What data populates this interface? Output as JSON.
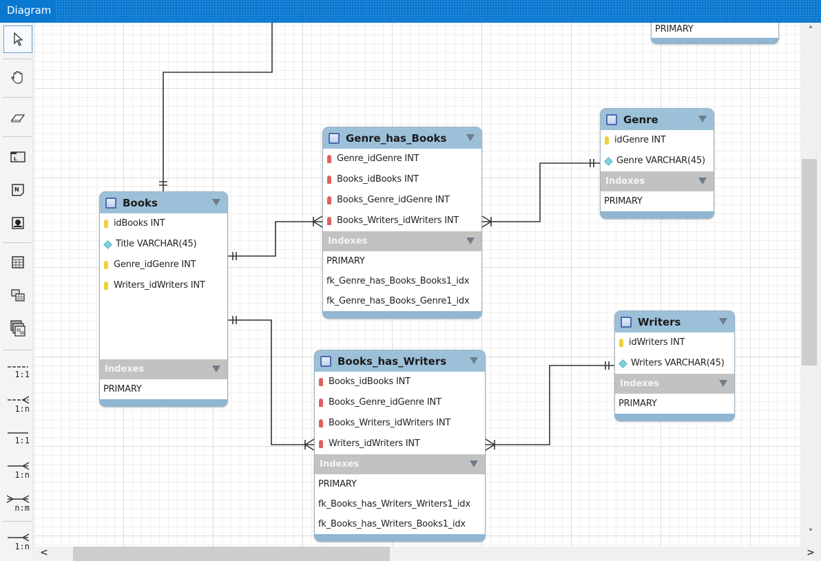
{
  "window": {
    "title": "Diagram"
  },
  "toolbar": {
    "tools": [
      {
        "name": "select-tool",
        "icon": "pointer-icon"
      },
      {
        "name": "hand-tool",
        "icon": "hand-icon"
      },
      {
        "name": "eraser-tool",
        "icon": "eraser-icon"
      },
      {
        "name": "layer-tool",
        "icon": "layer-icon",
        "glyph": "L"
      },
      {
        "name": "note-tool",
        "icon": "note-icon",
        "glyph": "N"
      },
      {
        "name": "image-tool",
        "icon": "image-icon"
      },
      {
        "name": "table-tool",
        "icon": "table-icon"
      },
      {
        "name": "view-tool",
        "icon": "view-icon"
      },
      {
        "name": "routine-group-tool",
        "icon": "routine-group-icon"
      },
      {
        "name": "rel-1-1-non-identifying",
        "label": "1:1"
      },
      {
        "name": "rel-1-n-non-identifying",
        "label": "1:n"
      },
      {
        "name": "rel-1-1-identifying",
        "label": "1:1"
      },
      {
        "name": "rel-1-n-identifying",
        "label": "1:n"
      },
      {
        "name": "rel-n-m-identifying",
        "label": "n:m"
      },
      {
        "name": "rel-1-n-existing-columns",
        "label": "1:n"
      }
    ]
  },
  "entities": {
    "partial": {
      "indexes": [
        "PRIMARY"
      ]
    },
    "books": {
      "title": "Books",
      "columns": [
        {
          "name": "idBooks INT",
          "kind": "pk"
        },
        {
          "name": "Title VARCHAR(45)",
          "kind": "attr"
        },
        {
          "name": "Genre_idGenre INT",
          "kind": "pk"
        },
        {
          "name": "Writers_idWriters INT",
          "kind": "pk"
        }
      ],
      "indexes_label": "Indexes",
      "indexes": [
        "PRIMARY"
      ]
    },
    "genre_has_books": {
      "title": "Genre_has_Books",
      "columns": [
        {
          "name": "Genre_idGenre INT",
          "kind": "fk"
        },
        {
          "name": "Books_idBooks INT",
          "kind": "fk"
        },
        {
          "name": "Books_Genre_idGenre INT",
          "kind": "fk"
        },
        {
          "name": "Books_Writers_idWriters INT",
          "kind": "fk"
        }
      ],
      "indexes_label": "Indexes",
      "indexes": [
        "PRIMARY",
        "fk_Genre_has_Books_Books1_idx",
        "fk_Genre_has_Books_Genre1_idx"
      ]
    },
    "genre": {
      "title": "Genre",
      "columns": [
        {
          "name": "idGenre INT",
          "kind": "pk"
        },
        {
          "name": "Genre VARCHAR(45)",
          "kind": "attr"
        }
      ],
      "indexes_label": "Indexes",
      "indexes": [
        "PRIMARY"
      ]
    },
    "books_has_writers": {
      "title": "Books_has_Writers",
      "columns": [
        {
          "name": "Books_idBooks INT",
          "kind": "fk"
        },
        {
          "name": "Books_Genre_idGenre INT",
          "kind": "fk"
        },
        {
          "name": "Books_Writers_idWriters INT",
          "kind": "fk"
        },
        {
          "name": "Writers_idWriters INT",
          "kind": "fk"
        }
      ],
      "indexes_label": "Indexes",
      "indexes": [
        "PRIMARY",
        "fk_Books_has_Writers_Writers1_idx",
        "fk_Books_has_Writers_Books1_idx"
      ]
    },
    "writers": {
      "title": "Writers",
      "columns": [
        {
          "name": "idWriters INT",
          "kind": "pk"
        },
        {
          "name": "Writers VARCHAR(45)",
          "kind": "attr"
        }
      ],
      "indexes_label": "Indexes",
      "indexes": [
        "PRIMARY"
      ]
    }
  },
  "relationships": [
    {
      "from": "offscreen",
      "to": "Books",
      "type": "one-to-one-mandatory"
    },
    {
      "from": "Books",
      "to": "Genre_has_Books",
      "type": "one-to-many"
    },
    {
      "from": "Genre",
      "to": "Genre_has_Books",
      "type": "one-to-many"
    },
    {
      "from": "Books",
      "to": "Books_has_Writers",
      "type": "one-to-many"
    },
    {
      "from": "Writers",
      "to": "Books_has_Writers",
      "type": "one-to-many"
    }
  ],
  "scrollbars": {
    "up_arrow": "˄",
    "down_arrow": "˅",
    "left_arrow": "<",
    "right_arrow": ">"
  }
}
